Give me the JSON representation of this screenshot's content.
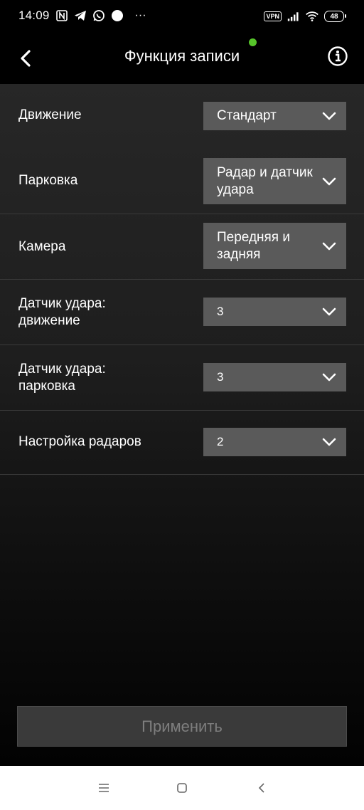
{
  "status_bar": {
    "time": "14:09",
    "vpn": "VPN",
    "battery": "48",
    "more": "···"
  },
  "header": {
    "title": "Функция записи",
    "recording_dot_color": "#56c42a"
  },
  "settings": [
    {
      "label": "Движение",
      "value": "Стандарт"
    },
    {
      "label": "Парковка",
      "value": "Радар и датчик удара"
    },
    {
      "label": "Камера",
      "value": "Передняя и задняя"
    },
    {
      "label": "Датчик удара: движение",
      "value": "3"
    },
    {
      "label": "Датчик удара: парковка",
      "value": "3"
    },
    {
      "label": "Настройка радаров",
      "value": "2"
    }
  ],
  "apply_button": {
    "label": "Применить"
  },
  "nav": {
    "menu_icon": "menu-icon",
    "home_icon": "home-icon",
    "back_icon": "back-triangle-icon"
  }
}
